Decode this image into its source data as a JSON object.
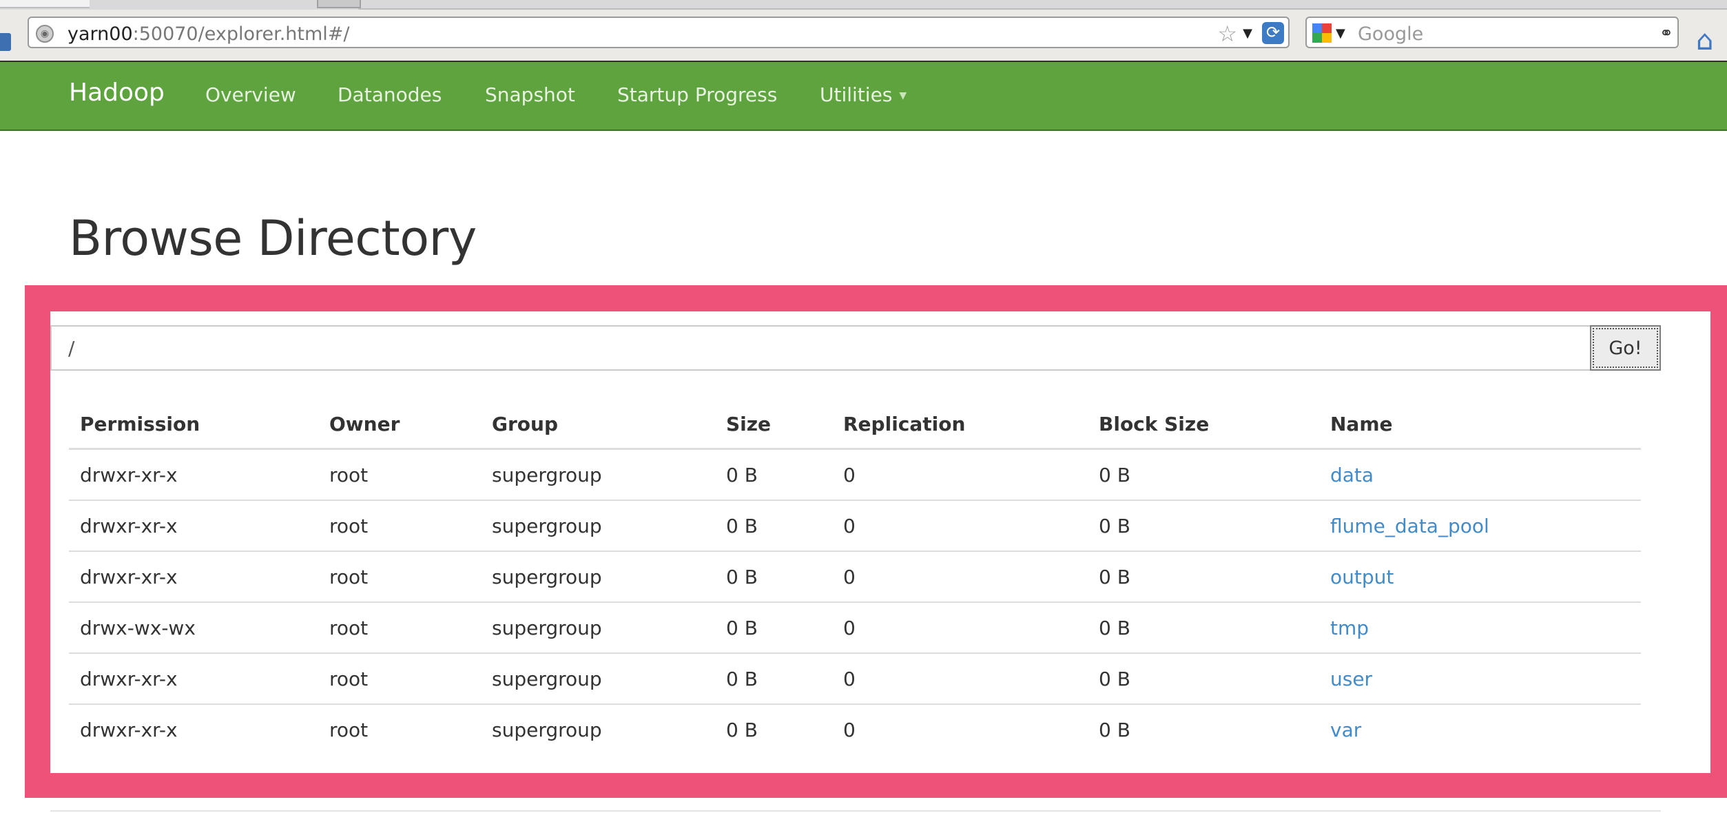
{
  "browser": {
    "url_host": "yarn00",
    "url_rest": ":50070/explorer.html#/",
    "search_placeholder": "Google"
  },
  "navbar": {
    "brand": "Hadoop",
    "items": [
      {
        "label": "Overview"
      },
      {
        "label": "Datanodes"
      },
      {
        "label": "Snapshot"
      },
      {
        "label": "Startup Progress"
      },
      {
        "label": "Utilities"
      }
    ],
    "colors": {
      "background": "#5fa33e",
      "text": "#ffffff"
    }
  },
  "page": {
    "title": "Browse Directory",
    "path_value": "/",
    "go_label": "Go!",
    "highlight_color": "#ee5278",
    "link_color": "#428bca"
  },
  "table": {
    "headers": [
      "Permission",
      "Owner",
      "Group",
      "Size",
      "Replication",
      "Block Size",
      "Name"
    ],
    "rows": [
      [
        "drwxr-xr-x",
        "root",
        "supergroup",
        "0 B",
        "0",
        "0 B",
        "data"
      ],
      [
        "drwxr-xr-x",
        "root",
        "supergroup",
        "0 B",
        "0",
        "0 B",
        "flume_data_pool"
      ],
      [
        "drwxr-xr-x",
        "root",
        "supergroup",
        "0 B",
        "0",
        "0 B",
        "output"
      ],
      [
        "drwx-wx-wx",
        "root",
        "supergroup",
        "0 B",
        "0",
        "0 B",
        "tmp"
      ],
      [
        "drwxr-xr-x",
        "root",
        "supergroup",
        "0 B",
        "0",
        "0 B",
        "user"
      ],
      [
        "drwxr-xr-x",
        "root",
        "supergroup",
        "0 B",
        "0",
        "0 B",
        "var"
      ]
    ]
  },
  "icons": [
    "globe-icon",
    "bookmark-star-icon",
    "reload-icon",
    "google-icon",
    "binoculars-icon",
    "home-icon",
    "caret-down-icon"
  ]
}
